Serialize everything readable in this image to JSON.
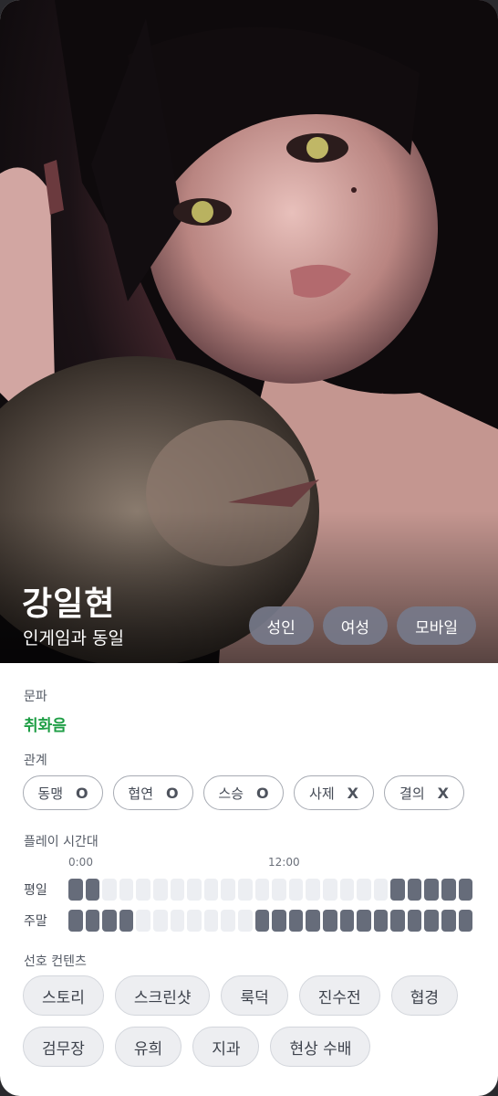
{
  "profile": {
    "name": "강일현",
    "subtitle": "인게임과 동일",
    "tags": [
      "성인",
      "여성",
      "모바일"
    ]
  },
  "faction": {
    "label": "문파",
    "value": "취화음"
  },
  "relations": {
    "label": "관계",
    "items": [
      {
        "label": "동맹",
        "mark": "O"
      },
      {
        "label": "협연",
        "mark": "O"
      },
      {
        "label": "스승",
        "mark": "O"
      },
      {
        "label": "사제",
        "mark": "X"
      },
      {
        "label": "결의",
        "mark": "X"
      }
    ]
  },
  "playtime": {
    "label": "플레이 시간대",
    "tick_0": "0:00",
    "tick_12": "12:00",
    "weekday_label": "평일",
    "weekend_label": "주말",
    "weekday_hours": [
      1,
      1,
      0,
      0,
      0,
      0,
      0,
      0,
      0,
      0,
      0,
      0,
      0,
      0,
      0,
      0,
      0,
      0,
      0,
      1,
      1,
      1,
      1,
      1
    ],
    "weekend_hours": [
      1,
      1,
      1,
      1,
      0,
      0,
      0,
      0,
      0,
      0,
      0,
      1,
      1,
      1,
      1,
      1,
      1,
      1,
      1,
      1,
      1,
      1,
      1,
      1
    ]
  },
  "preferences": {
    "label": "선호 컨텐츠",
    "row1": [
      "스토리",
      "스크린샷",
      "룩덕",
      "진수전",
      "협경"
    ],
    "row2": [
      "검무장",
      "유희",
      "지과",
      "현상 수배"
    ]
  },
  "colors": {
    "accent_green": "#1e9e45",
    "slot_on": "#666c7a",
    "slot_off": "#eceef2"
  }
}
